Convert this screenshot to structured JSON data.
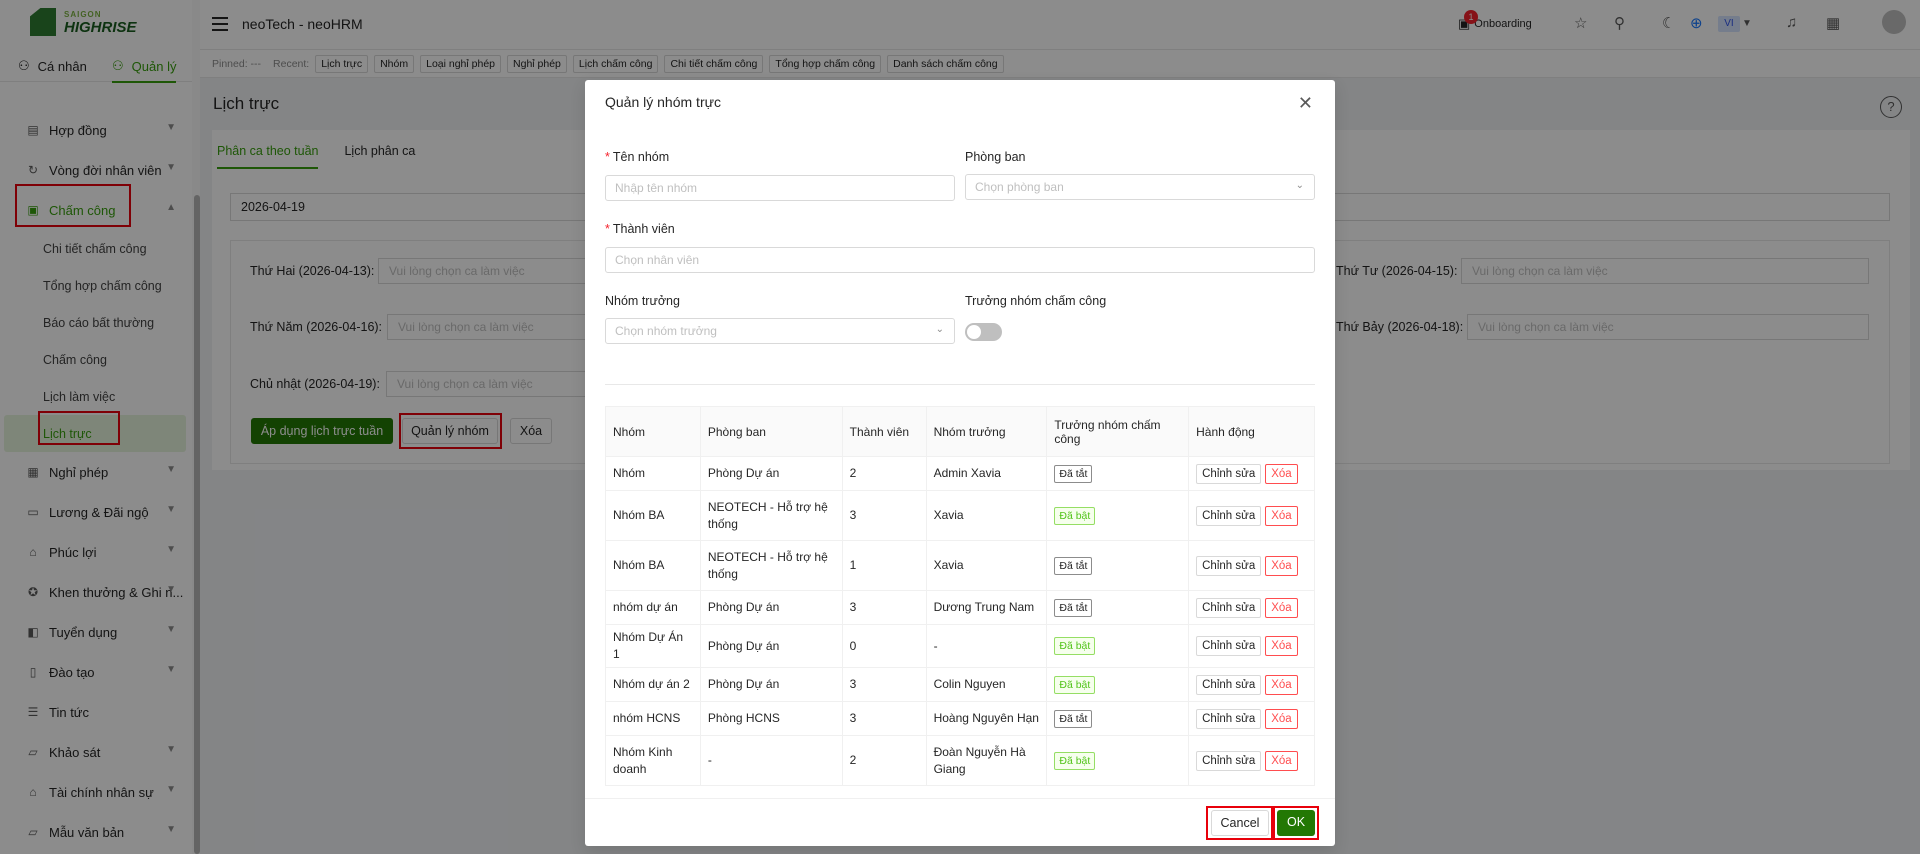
{
  "logo": {
    "top": "SAIGON",
    "bottom": "HIGHRISE"
  },
  "mode_tabs": {
    "personal": "Cá nhân",
    "manage": "Quản lý"
  },
  "menu": {
    "contract": "Hợp đồng",
    "lifecycle": "Vòng đời nhân viên",
    "attendance": "Chấm công",
    "sub": {
      "detail": "Chi tiết chấm công",
      "summary": "Tổng hợp chấm công",
      "anomaly": "Báo cáo bất thường",
      "checkin": "Chấm công",
      "work_schedule": "Lịch làm việc",
      "duty_schedule": "Lịch trực"
    },
    "leave": "Nghỉ phép",
    "salary": "Lương & Đãi ngộ",
    "benefit": "Phúc lợi",
    "reward": "Khen thưởng & Ghi n...",
    "recruit": "Tuyển dụng",
    "training": "Đào tạo",
    "news": "Tin tức",
    "survey": "Khảo sát",
    "finance": "Tài chính nhân sự",
    "templates": "Mẫu văn bản"
  },
  "header": {
    "title": "neoTech - neoHRM",
    "onboarding": "Onboarding",
    "onboarding_badge": "1",
    "lang": "VI"
  },
  "recent": {
    "pinned": "Pinned: ---",
    "recent_label": "Recent:",
    "chips": [
      "Lịch trực",
      "Nhóm",
      "Loại nghỉ phép",
      "Nghỉ phép",
      "Lịch chấm công",
      "Chi tiết chấm công",
      "Tổng hợp chấm công",
      "Danh sách chấm công"
    ]
  },
  "page": {
    "title": "Lịch trực",
    "tabs": {
      "weekly": "Phân ca theo tuần",
      "shift_schedule": "Lịch phân ca"
    },
    "date": "2026-04-19",
    "days": {
      "mon": "Thứ Hai (2026-04-13):",
      "wed": "Thứ Tư (2026-04-15):",
      "thu": "Thứ Năm (2026-04-16):",
      "sat": "Thứ Bảy (2026-04-18):",
      "sun": "Chủ nhật (2026-04-19):"
    },
    "shift_placeholder": "Vui lòng chọn ca làm việc",
    "buttons": {
      "apply": "Áp dụng lịch trực tuần",
      "manage_group": "Quản lý nhóm",
      "delete": "Xóa"
    }
  },
  "modal": {
    "title": "Quản lý nhóm trực",
    "group_name_label": "Tên nhóm",
    "group_name_placeholder": "Nhập tên nhóm",
    "dept_label": "Phòng ban",
    "dept_placeholder": "Chọn phòng ban",
    "members_label": "Thành viên",
    "members_placeholder": "Chọn nhân viên",
    "leader_label": "Nhóm trưởng",
    "leader_placeholder": "Chọn nhóm trưởng",
    "leader_att_label": "Trưởng nhóm chấm công",
    "table": {
      "headers": [
        "Nhóm",
        "Phòng ban",
        "Thành viên",
        "Nhóm trưởng",
        "Trưởng nhóm chấm công",
        "Hành động"
      ],
      "rows": [
        {
          "name": "Nhóm",
          "dept": "Phòng Dự án",
          "members": "2",
          "leader": "Admin Xavia",
          "status": "Đã tắt",
          "on": false
        },
        {
          "name": "Nhóm BA",
          "dept": "NEOTECH - Hỗ trợ hệ thống",
          "members": "3",
          "leader": "Xavia",
          "status": "Đã bật",
          "on": true
        },
        {
          "name": "Nhóm BA",
          "dept": "NEOTECH - Hỗ trợ hệ thống",
          "members": "1",
          "leader": "Xavia",
          "status": "Đã tắt",
          "on": false
        },
        {
          "name": "nhóm dự án",
          "dept": "Phòng Dự án",
          "members": "3",
          "leader": "Dương Trung Nam",
          "status": "Đã tắt",
          "on": false
        },
        {
          "name": "Nhóm Dự Án 1",
          "dept": "Phòng Dự án",
          "members": "0",
          "leader": "-",
          "status": "Đã bật",
          "on": true
        },
        {
          "name": "Nhóm dự án 2",
          "dept": "Phòng Dự án",
          "members": "3",
          "leader": "Colin Nguyen",
          "status": "Đã bật",
          "on": true
        },
        {
          "name": "nhóm HCNS",
          "dept": "Phòng HCNS",
          "members": "3",
          "leader": "Hoàng Nguyên Hạn",
          "status": "Đã tắt",
          "on": false
        },
        {
          "name": "Nhóm Kinh doanh",
          "dept": "-",
          "members": "2",
          "leader": "Đoàn Nguyễn Hà Giang",
          "status": "Đã bật",
          "on": true
        }
      ],
      "edit_label": "Chỉnh sửa",
      "delete_label": "Xóa"
    },
    "cancel": "Cancel",
    "ok": "OK"
  },
  "colors": {
    "accent": "#389e0d",
    "primary_btn": "#237804",
    "highlight": "#e8000b"
  }
}
